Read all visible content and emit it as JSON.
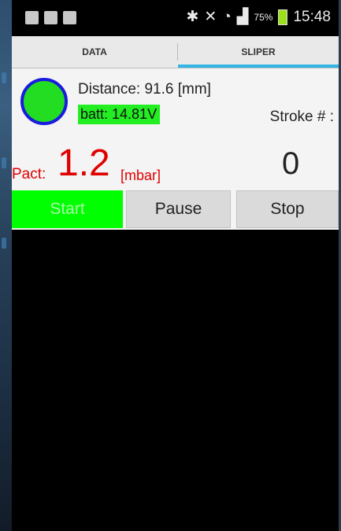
{
  "status_bar": {
    "battery_percent": "75%",
    "time": "15:48",
    "left_icons": [
      "notification-icon",
      "gallery-icon",
      "mail-icon"
    ],
    "right_icons": [
      "bluetooth-icon",
      "mute-icon",
      "wifi-icon",
      "signal-icon",
      "battery-icon"
    ]
  },
  "tabs": [
    {
      "label": "DATA",
      "selected": false
    },
    {
      "label": "SLIPER",
      "selected": true
    }
  ],
  "main": {
    "distance_text": "Distance: 91.6 [mm]",
    "battery_text": "batt: 14.81V",
    "stroke_label": "Stroke # :",
    "stroke_count": "0",
    "pact_label": "Pact:",
    "pact_value": "1.2",
    "pact_unit": "[mbar]"
  },
  "buttons": {
    "start": "Start",
    "pause": "Pause",
    "stop": "Stop"
  },
  "colors": {
    "accent_tab": "#33b5e5",
    "status_green": "#22ee22",
    "pact_red": "#e00000",
    "indicator_ring": "#1a1ae0"
  }
}
